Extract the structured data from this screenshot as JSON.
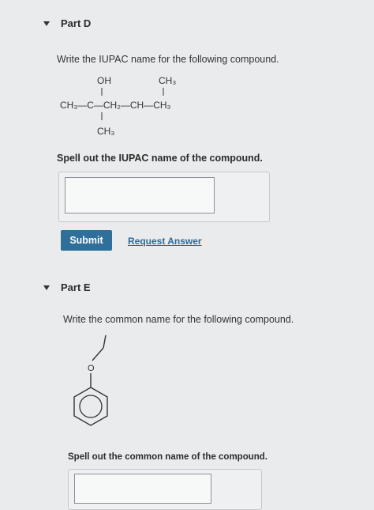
{
  "partD": {
    "title": "Part D",
    "prompt": "Write the IUPAC name for the following compound.",
    "structure": {
      "oh": "OH",
      "ch3_top": "CH₃",
      "main_chain": "CH₃—C—CH₂—CH—CH₃",
      "ch3_bottom": "CH₃"
    },
    "answer_label": "Spell out the IUPAC name of the compound.",
    "answer_value": "",
    "submit_label": "Submit",
    "request_answer_label": "Request Answer"
  },
  "partE": {
    "title": "Part E",
    "prompt": "Write the common name for the following compound.",
    "structure": {
      "o_atom": "O"
    },
    "answer_label": "Spell out the common name of the compound.",
    "answer_value": ""
  }
}
